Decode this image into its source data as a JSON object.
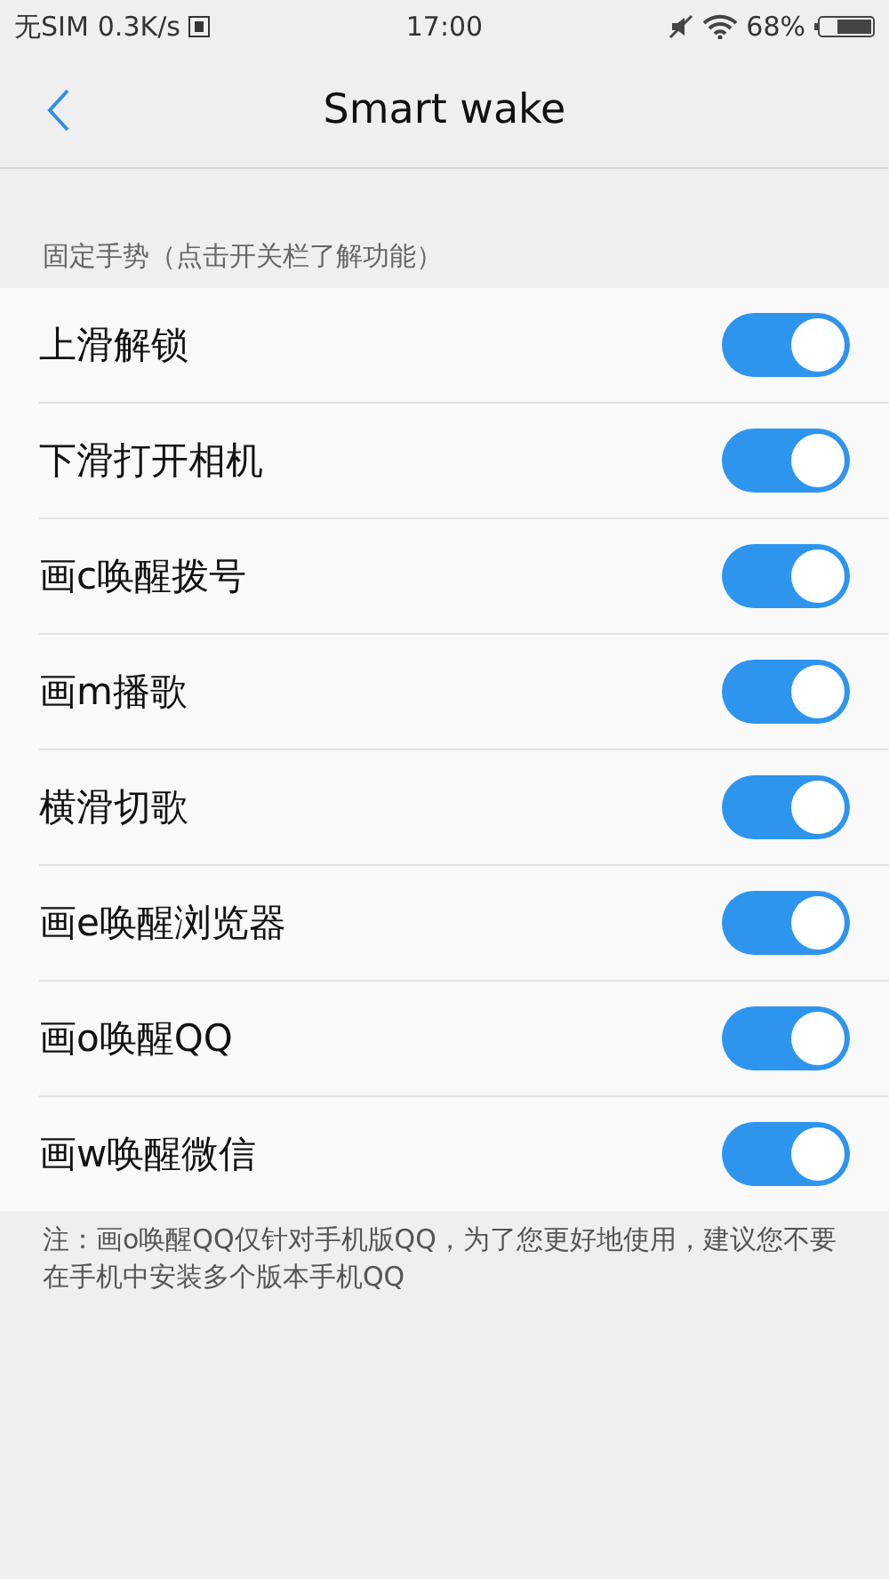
{
  "status_bar": {
    "carrier": "无SIM",
    "speed": "0.3K/s",
    "time": "17:00",
    "battery_text": "68%"
  },
  "header": {
    "title": "Smart wake"
  },
  "section_label": "固定手势（点击开关栏了解功能）",
  "gestures": [
    {
      "label": "上滑解锁",
      "on": true
    },
    {
      "label": "下滑打开相机",
      "on": true
    },
    {
      "label": "画c唤醒拨号",
      "on": true
    },
    {
      "label": "画m播歌",
      "on": true
    },
    {
      "label": "横滑切歌",
      "on": true
    },
    {
      "label": "画e唤醒浏览器",
      "on": true
    },
    {
      "label": "画o唤醒QQ",
      "on": true
    },
    {
      "label": "画w唤醒微信",
      "on": true
    }
  ],
  "note": "注：画o唤醒QQ仅针对手机版QQ，为了您更好地使用，建议您不要在手机中安装多个版本手机QQ"
}
